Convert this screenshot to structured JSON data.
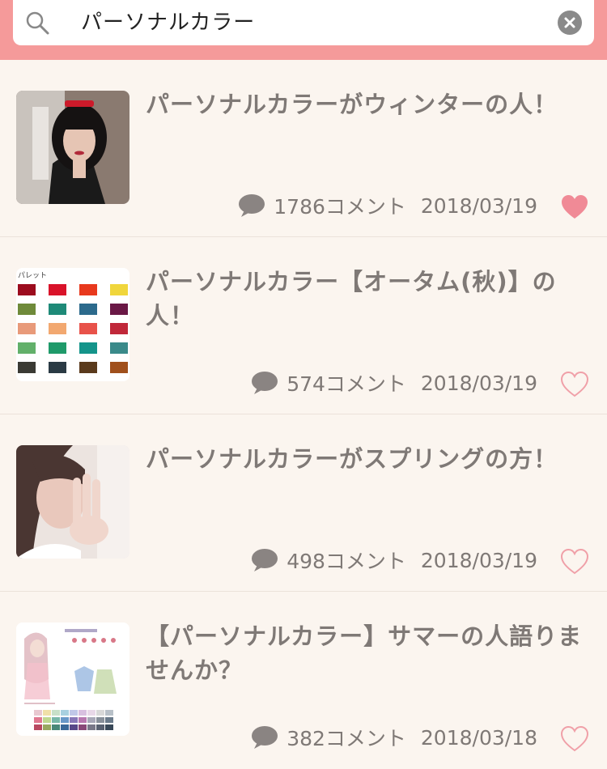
{
  "search": {
    "query": "パーソナルカラー"
  },
  "results": [
    {
      "title": "パーソナルカラーがウィンターの人！",
      "comments": "1786コメント",
      "date": "2018/03/19",
      "liked": true
    },
    {
      "title": "パーソナルカラー【オータム(秋)】の人！",
      "comments": "574コメント",
      "date": "2018/03/19",
      "liked": false,
      "palette_label": "パレット",
      "palette": [
        "#9c0c1e",
        "#d9132a",
        "#e8391d",
        "#f0d63c",
        "#6f8a3a",
        "#1e8a78",
        "#2c6a8c",
        "#6a1846",
        "#e89a7a",
        "#f2a870",
        "#e8524a",
        "#c0283a",
        "#62b06a",
        "#1f9a6a",
        "#14948a",
        "#3a8a8a",
        "#3a3a34",
        "#2a3a44",
        "#5a3a1c",
        "#a0501c"
      ]
    },
    {
      "title": "パーソナルカラーがスプリングの方！",
      "comments": "498コメント",
      "date": "2018/03/19",
      "liked": false
    },
    {
      "title": "【パーソナルカラー】サマーの人語りませんか？",
      "comments": "382コメント",
      "date": "2018/03/18",
      "liked": false
    }
  ],
  "colors": {
    "header": "#f59a9a",
    "liked": "#f08a96",
    "outline": "#f0a0a8"
  }
}
